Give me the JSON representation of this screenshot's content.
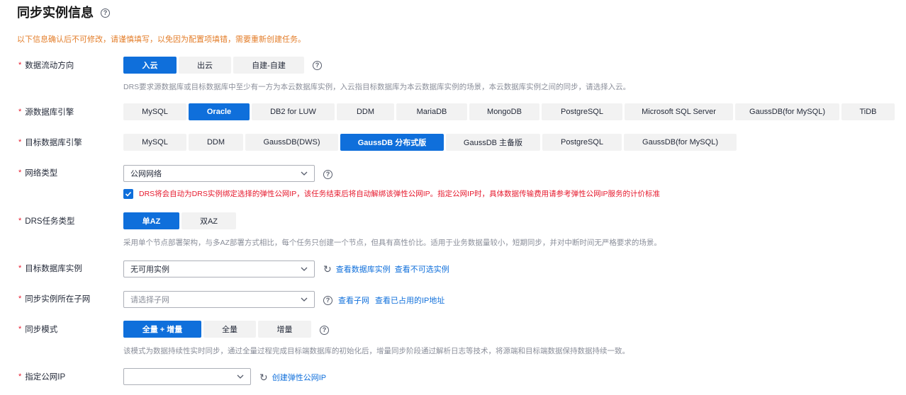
{
  "title": "同步实例信息",
  "notice": "以下信息确认后不可修改，请谨慎填写，以免因为配置项填错，需要重新创建任务。",
  "flow": {
    "label": "数据流动方向",
    "options": [
      "入云",
      "出云",
      "自建-自建"
    ],
    "selected": "入云",
    "desc": "DRS要求源数据库或目标数据库中至少有一方为本云数据库实例，入云指目标数据库为本云数据库实例的场景，本云数据库实例之间的同步，请选择入云。"
  },
  "source_engine": {
    "label": "源数据库引擎",
    "options": [
      "MySQL",
      "Oracle",
      "DB2 for LUW",
      "DDM",
      "MariaDB",
      "MongoDB",
      "PostgreSQL",
      "Microsoft SQL Server",
      "GaussDB(for MySQL)",
      "TiDB"
    ],
    "selected": "Oracle"
  },
  "target_engine": {
    "label": "目标数据库引擎",
    "options": [
      "MySQL",
      "DDM",
      "GaussDB(DWS)",
      "GaussDB 分布式版",
      "GaussDB 主备版",
      "PostgreSQL",
      "GaussDB(for MySQL)"
    ],
    "selected": "GaussDB 分布式版"
  },
  "network": {
    "label": "网络类型",
    "value": "公网网络",
    "checkbox_checked": true,
    "checkbox_text": "DRS将会自动为DRS实例绑定选择的弹性公网IP，该任务结束后将自动解绑该弹性公网IP。指定公网IP时，具体数据传输费用请参考弹性公网IP服务的计价标准"
  },
  "task_type": {
    "label": "DRS任务类型",
    "options": [
      "单AZ",
      "双AZ"
    ],
    "selected": "单AZ",
    "desc": "采用单个节点部署架构，与多AZ部署方式相比，每个任务只创建一个节点，但具有高性价比。适用于业务数据量较小，短期同步，并对中断时间无严格要求的场景。"
  },
  "target_instance": {
    "label": "目标数据库实例",
    "placeholder": "无可用实例",
    "link1": "查看数据库实例",
    "link2": "查看不可选实例"
  },
  "subnet": {
    "label": "同步实例所在子网",
    "placeholder": "请选择子网",
    "link1": "查看子网",
    "link2": "查看已占用的IP地址"
  },
  "sync_mode": {
    "label": "同步模式",
    "options": [
      "全量 + 增量",
      "全量",
      "增量"
    ],
    "selected": "全量 + 增量",
    "desc": "该模式为数据持续性实时同步，通过全量过程完成目标端数据库的初始化后，增量同步阶段通过解析日志等技术，将源端和目标端数据保持数据持续一致。"
  },
  "public_ip": {
    "label": "指定公网IP",
    "value": "",
    "link": "创建弹性公网IP"
  },
  "colors": {
    "primary": "#0f6fdb",
    "required": "#e6192d",
    "notice": "#e37d29"
  },
  "icons": {
    "help": "question-circle",
    "refresh": "refresh",
    "chevron": "chevron-down"
  }
}
